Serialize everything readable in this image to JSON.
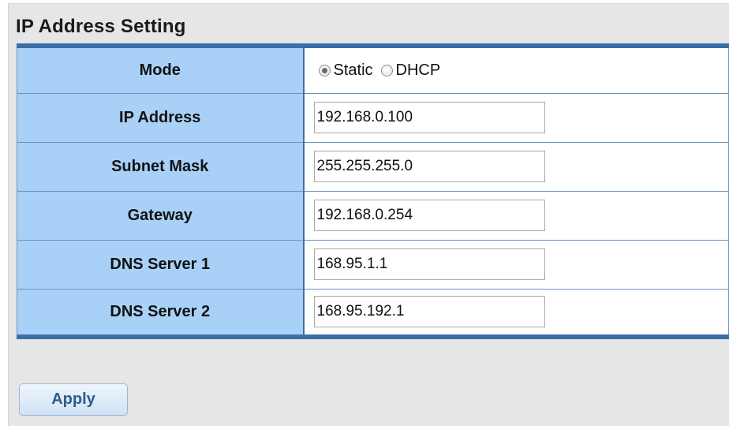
{
  "section": {
    "title": "IP Address Setting"
  },
  "form": {
    "mode": {
      "label": "Mode",
      "options": [
        {
          "label": "Static",
          "selected": true
        },
        {
          "label": "DHCP",
          "selected": false
        }
      ]
    },
    "ip_address": {
      "label": "IP Address",
      "value": "192.168.0.100"
    },
    "subnet_mask": {
      "label": "Subnet Mask",
      "value": "255.255.255.0"
    },
    "gateway": {
      "label": "Gateway",
      "value": "192.168.0.254"
    },
    "dns_server_1": {
      "label": "DNS Server 1",
      "value": "168.95.1.1"
    },
    "dns_server_2": {
      "label": "DNS Server 2",
      "value": "168.95.192.1"
    }
  },
  "actions": {
    "apply_label": "Apply"
  },
  "colors": {
    "label_cell_bg": "#a9d1f7",
    "table_border": "#3a6ea8",
    "panel_bg": "#e6e6e6",
    "button_text": "#2f5d8a"
  }
}
